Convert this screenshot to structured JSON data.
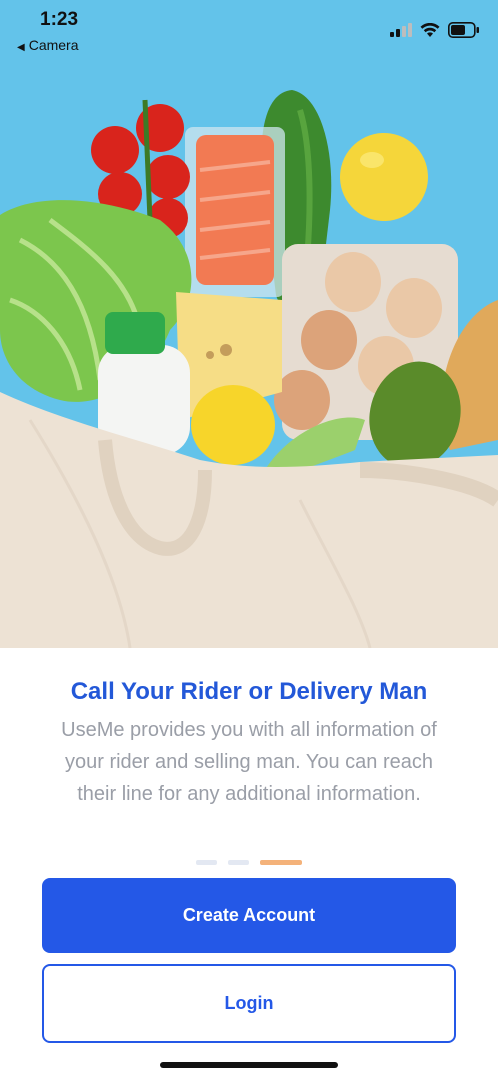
{
  "status_bar": {
    "time": "1:23",
    "back_app": "Camera",
    "signal_icon": "cellular-signal-icon",
    "wifi_icon": "wifi-icon",
    "battery_icon": "battery-icon"
  },
  "hero": {
    "image": "groceries-in-tote-bag-photo"
  },
  "onboarding": {
    "title": "Call Your Rider or Delivery Man",
    "description": "UseMe provides you with all information of your rider and selling man. You can reach their line for any additional information.",
    "page_count": 3,
    "active_page": 3
  },
  "actions": {
    "create_account_label": "Create Account",
    "login_label": "Login"
  },
  "colors": {
    "accent": "#2458e7",
    "title": "#2358d8",
    "description": "#9a9ea7",
    "dot_inactive": "#e3e8f2",
    "dot_active": "#f4b27a",
    "hero_background": "#63c3ea"
  }
}
